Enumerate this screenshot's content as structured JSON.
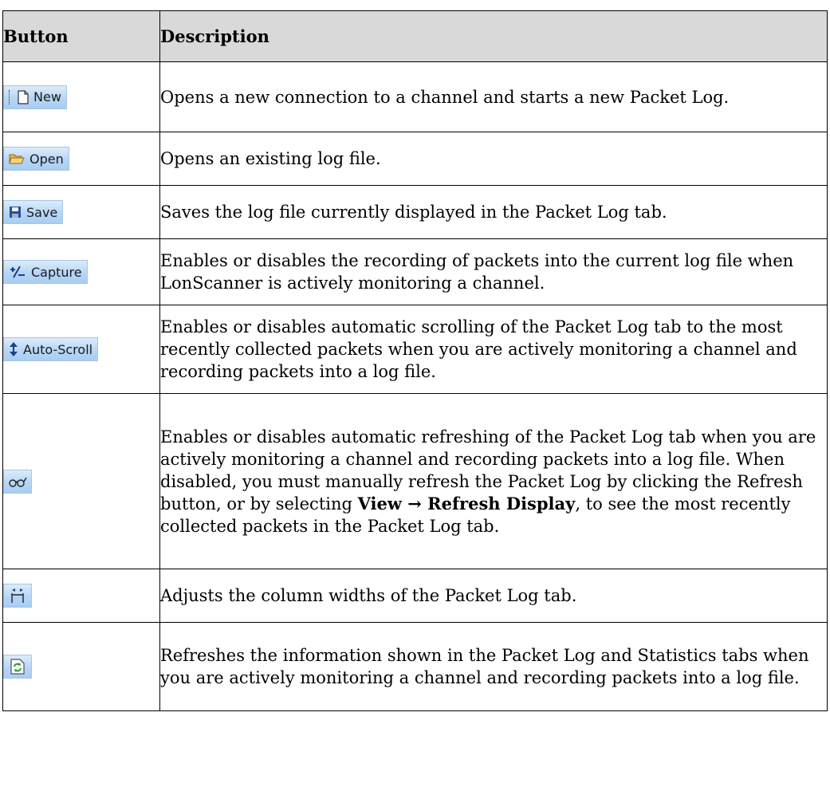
{
  "header": {
    "button": "Button",
    "description": "Description"
  },
  "rows": [
    {
      "icon": "new-document-icon",
      "label": "New",
      "description": "Opens a new connection to a channel and starts a new Packet Log."
    },
    {
      "icon": "open-folder-icon",
      "label": "Open",
      "description": "Opens an existing log file."
    },
    {
      "icon": "floppy-disk-icon",
      "label": "Save",
      "description": "Saves the log file currently displayed in the Packet Log tab."
    },
    {
      "icon": "capture-icon",
      "label": "Capture",
      "description": "Enables or disables the recording of packets into the current log file when LonScanner is actively monitoring a channel."
    },
    {
      "icon": "vertical-arrows-icon",
      "label": "Auto-Scroll",
      "description": "Enables or disables automatic scrolling of the Packet Log tab to the most recently collected packets when you are actively monitoring a channel and recording packets into a log file."
    },
    {
      "icon": "glasses-icon",
      "label": "",
      "description_parts": {
        "before": "Enables or disables automatic refreshing of the Packet Log tab when you are actively monitoring a channel and recording packets into a log file.  When disabled, you must manually refresh the Packet Log by clicking the Refresh button, or by selecting ",
        "menu_path": "View → Refresh Display",
        "after": ", to see the most recently collected packets in the Packet Log tab."
      }
    },
    {
      "icon": "column-width-icon",
      "label": "",
      "description": "Adjusts the column widths of the Packet Log tab."
    },
    {
      "icon": "refresh-icon",
      "label": "",
      "description": "Refreshes the information shown in the Packet Log and Statistics tabs when you are actively monitoring a channel and recording packets into a log file."
    }
  ]
}
